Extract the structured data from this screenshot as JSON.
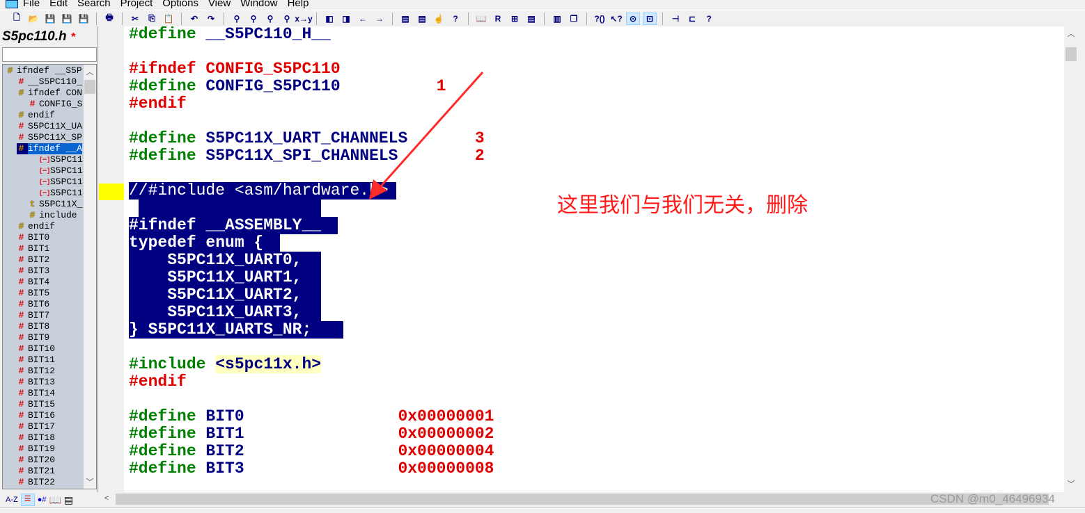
{
  "menu": [
    "File",
    "Edit",
    "Search",
    "Project",
    "Options",
    "View",
    "Window",
    "Help"
  ],
  "toolbar": [
    "new-file",
    "open-file",
    "save",
    "save-as",
    "save-all",
    "print",
    "cut",
    "copy",
    "paste",
    "undo",
    "redo",
    "find",
    "find-prev",
    "find-next",
    "find-in-files",
    "replace",
    "bookmark-prev",
    "bookmark-next",
    "back",
    "forward",
    "jump-def",
    "jump-ref",
    "lookup-symbol",
    "help-index",
    "browse",
    "relation",
    "tile-panes",
    "pane-1",
    "pane-2",
    "cascade",
    "context-help",
    "whats-this",
    "toggle-symbols",
    "toggle-overview",
    "layout-1",
    "layout-2",
    "project-help"
  ],
  "left": {
    "title": "S5pc110.h",
    "modified": "*",
    "search_value": "",
    "tree": [
      {
        "t": "ifndef __S5P",
        "i": "y",
        "d": 0
      },
      {
        "t": "__S5PC110_",
        "i": "r",
        "d": 1
      },
      {
        "t": "ifndef CON",
        "i": "y",
        "d": 1
      },
      {
        "t": "CONFIG_S",
        "i": "r",
        "d": 2
      },
      {
        "t": "endif",
        "i": "y",
        "d": 1
      },
      {
        "t": "S5PC11X_UA",
        "i": "r",
        "d": 1
      },
      {
        "t": "S5PC11X_SP",
        "i": "r",
        "d": 1
      },
      {
        "t": "ifndef __A",
        "i": "y",
        "d": 1,
        "sel": true
      },
      {
        "t": "S5PC11",
        "i": "m",
        "d": 3
      },
      {
        "t": "S5PC11",
        "i": "m",
        "d": 3
      },
      {
        "t": "S5PC11",
        "i": "m",
        "d": 3
      },
      {
        "t": "S5PC11",
        "i": "m",
        "d": 3
      },
      {
        "t": "S5PC11X_",
        "i": "t",
        "d": 2
      },
      {
        "t": "include",
        "i": "y",
        "d": 2
      },
      {
        "t": "endif",
        "i": "y",
        "d": 1
      },
      {
        "t": "BIT0",
        "i": "r",
        "d": 1
      },
      {
        "t": "BIT1",
        "i": "r",
        "d": 1
      },
      {
        "t": "BIT2",
        "i": "r",
        "d": 1
      },
      {
        "t": "BIT3",
        "i": "r",
        "d": 1
      },
      {
        "t": "BIT4",
        "i": "r",
        "d": 1
      },
      {
        "t": "BIT5",
        "i": "r",
        "d": 1
      },
      {
        "t": "BIT6",
        "i": "r",
        "d": 1
      },
      {
        "t": "BIT7",
        "i": "r",
        "d": 1
      },
      {
        "t": "BIT8",
        "i": "r",
        "d": 1
      },
      {
        "t": "BIT9",
        "i": "r",
        "d": 1
      },
      {
        "t": "BIT10",
        "i": "r",
        "d": 1
      },
      {
        "t": "BIT11",
        "i": "r",
        "d": 1
      },
      {
        "t": "BIT12",
        "i": "r",
        "d": 1
      },
      {
        "t": "BIT13",
        "i": "r",
        "d": 1
      },
      {
        "t": "BIT14",
        "i": "r",
        "d": 1
      },
      {
        "t": "BIT15",
        "i": "r",
        "d": 1
      },
      {
        "t": "BIT16",
        "i": "r",
        "d": 1
      },
      {
        "t": "BIT17",
        "i": "r",
        "d": 1
      },
      {
        "t": "BIT18",
        "i": "r",
        "d": 1
      },
      {
        "t": "BIT19",
        "i": "r",
        "d": 1
      },
      {
        "t": "BIT20",
        "i": "r",
        "d": 1
      },
      {
        "t": "BIT21",
        "i": "r",
        "d": 1
      },
      {
        "t": "BIT22",
        "i": "r",
        "d": 1
      }
    ],
    "bottom_tools": [
      "A-Z",
      "symbol-list",
      "symbol-types",
      "book",
      "properties"
    ]
  },
  "code": [
    {
      "row": 0,
      "parts": [
        [
          "g",
          "#define "
        ],
        [
          "b",
          "__S5PC110_H__"
        ]
      ]
    },
    {
      "row": 2,
      "parts": [
        [
          "rd",
          "#ifndef CONFIG_S5PC110"
        ]
      ]
    },
    {
      "row": 3,
      "parts": [
        [
          "g",
          "#define "
        ],
        [
          "b",
          "CONFIG_S5PC110"
        ]
      ],
      "val": [
        "rd",
        "1"
      ],
      "col": 32
    },
    {
      "row": 4,
      "parts": [
        [
          "rd",
          "#endif"
        ]
      ]
    },
    {
      "row": 6,
      "parts": [
        [
          "g",
          "#define "
        ],
        [
          "b",
          "S5PC11X_UART_CHANNELS"
        ]
      ],
      "val": [
        "rd",
        "3"
      ],
      "col": 36
    },
    {
      "row": 7,
      "parts": [
        [
          "g",
          "#define "
        ],
        [
          "b",
          "S5PC11X_SPI_CHANNELS"
        ]
      ],
      "val": [
        "rd",
        "2"
      ],
      "col": 36
    },
    {
      "row": 9,
      "parts": [
        [
          "n",
          "//#include <asm/hardware.h>"
        ]
      ],
      "sel": true,
      "selw": "27.8ch",
      "normal": true
    },
    {
      "row": 10,
      "parts": [
        [
          "n",
          " "
        ]
      ],
      "sel": true,
      "selw": "19ch",
      "selx": "1ch"
    },
    {
      "row": 11,
      "parts": [
        [
          "n",
          "#ifndef __ASSEMBLY__"
        ]
      ],
      "sel": true,
      "selw": "21.7ch"
    },
    {
      "row": 12,
      "parts": [
        [
          "n",
          "typedef enum {"
        ]
      ],
      "sel": true,
      "selw": "15.7ch"
    },
    {
      "row": 13,
      "parts": [
        [
          "n",
          "    S5PC11X_UART0,"
        ]
      ],
      "sel": true,
      "selw": "20ch"
    },
    {
      "row": 14,
      "parts": [
        [
          "n",
          "    S5PC11X_UART1,"
        ]
      ],
      "sel": true,
      "selw": "20ch"
    },
    {
      "row": 15,
      "parts": [
        [
          "n",
          "    S5PC11X_UART2,"
        ]
      ],
      "sel": true,
      "selw": "20ch"
    },
    {
      "row": 16,
      "parts": [
        [
          "n",
          "    S5PC11X_UART3,"
        ]
      ],
      "sel": true,
      "selw": "20ch"
    },
    {
      "row": 17,
      "parts": [
        [
          "n",
          "} S5PC11X_UARTS_NR;"
        ]
      ],
      "sel": true,
      "selw": "22.3ch"
    },
    {
      "row": 19,
      "parts": [
        [
          "g",
          "#include "
        ],
        [
          "inc",
          "<s5pc11x.h>"
        ]
      ]
    },
    {
      "row": 20,
      "parts": [
        [
          "rd",
          "#endif"
        ]
      ]
    },
    {
      "row": 22,
      "parts": [
        [
          "g",
          "#define "
        ],
        [
          "b",
          "BIT0"
        ]
      ],
      "val": [
        "rd",
        "0x00000001"
      ],
      "col": 28
    },
    {
      "row": 23,
      "parts": [
        [
          "g",
          "#define "
        ],
        [
          "b",
          "BIT1"
        ]
      ],
      "val": [
        "rd",
        "0x00000002"
      ],
      "col": 28
    },
    {
      "row": 24,
      "parts": [
        [
          "g",
          "#define "
        ],
        [
          "b",
          "BIT2"
        ]
      ],
      "val": [
        "rd",
        "0x00000004"
      ],
      "col": 28
    },
    {
      "row": 25,
      "parts": [
        [
          "g",
          "#define "
        ],
        [
          "b",
          "BIT3"
        ]
      ],
      "val": [
        "rd",
        "0x00000008"
      ],
      "col": 28
    }
  ],
  "annotation": {
    "text": "这里我们与我们无关，删除",
    "color": "#ff1a1a"
  },
  "watermark": "CSDN @m0_46496934",
  "colors": {
    "selection": "#000080",
    "keyword": "#008000",
    "identifier": "#000080",
    "value": "#e00000"
  }
}
